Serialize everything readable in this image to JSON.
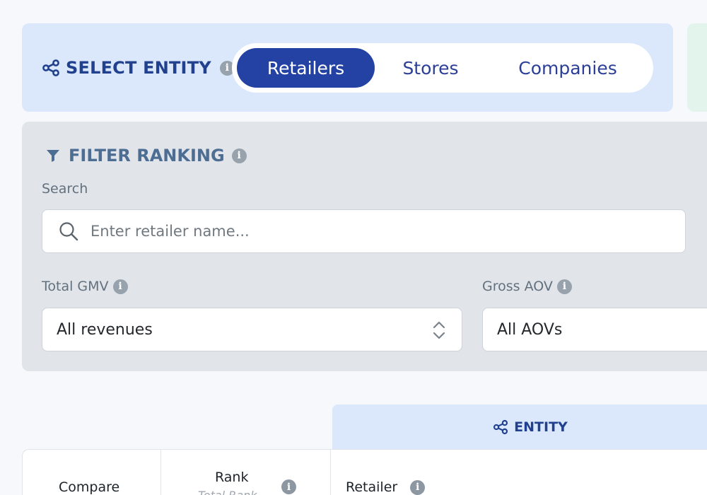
{
  "entity_selector": {
    "title": "SELECT ENTITY",
    "options": [
      "Retailers",
      "Stores",
      "Companies"
    ],
    "active": "Retailers"
  },
  "filter": {
    "title": "FILTER RANKING",
    "search_label": "Search",
    "search_placeholder": "Enter retailer name...",
    "gmv_label": "Total GMV",
    "gmv_value": "All revenues",
    "aov_label": "Gross AOV",
    "aov_value": "All AOVs"
  },
  "table": {
    "entity_tab": "ENTITY",
    "compare_header": "Compare",
    "rank_header": "Rank",
    "rank_sub": "Total Rank",
    "retailer_header": "Retailer"
  },
  "colors": {
    "accent": "#2342a4",
    "panel_blue": "#dbe8fb",
    "panel_gray": "#e1e5ea"
  }
}
